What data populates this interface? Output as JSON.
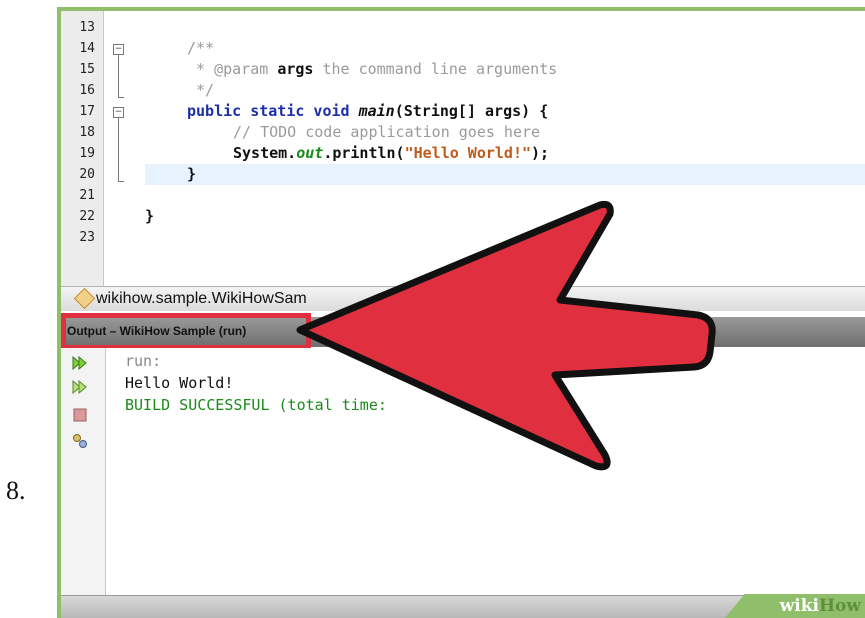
{
  "step_number": "8.",
  "editor": {
    "line_numbers": [
      "13",
      "14",
      "15",
      "16",
      "17",
      "18",
      "19",
      "20",
      "21",
      "22",
      "23"
    ],
    "lines": {
      "l14": "/**",
      "l15_star": " * ",
      "l15_tag": "@param",
      "l15_name": "args",
      "l15_rest": " the command line arguments",
      "l16": " */",
      "l17_kw": "public static void ",
      "l17_method": "main",
      "l17_rest": "(String[] args) {",
      "l18": "// TODO code application goes here",
      "l19_a": "System.",
      "l19_field": "out",
      "l19_b": ".println(",
      "l19_str": "\"Hello World!\"",
      "l19_c": ");",
      "l20": "}",
      "l22": "}"
    }
  },
  "tab": {
    "label": "wikihow.sample.WikiHowSam",
    "icon": "class-file-icon"
  },
  "output": {
    "title": "Output – WikiHow Sample (run)",
    "lines": [
      "run:",
      "Hello World!",
      "BUILD SUCCESSFUL (total time:"
    ],
    "toolbar_icons": [
      "rerun-icon",
      "rerun-alt-icon",
      "stop-icon",
      "settings-icon"
    ]
  },
  "watermark": {
    "part1": "wiki",
    "part2": "How"
  },
  "colors": {
    "frame": "#8fbf6a",
    "highlight": "#e0303f",
    "keyword": "#1a2fa8",
    "string": "#c05a1a",
    "success": "#1a8a1a"
  }
}
